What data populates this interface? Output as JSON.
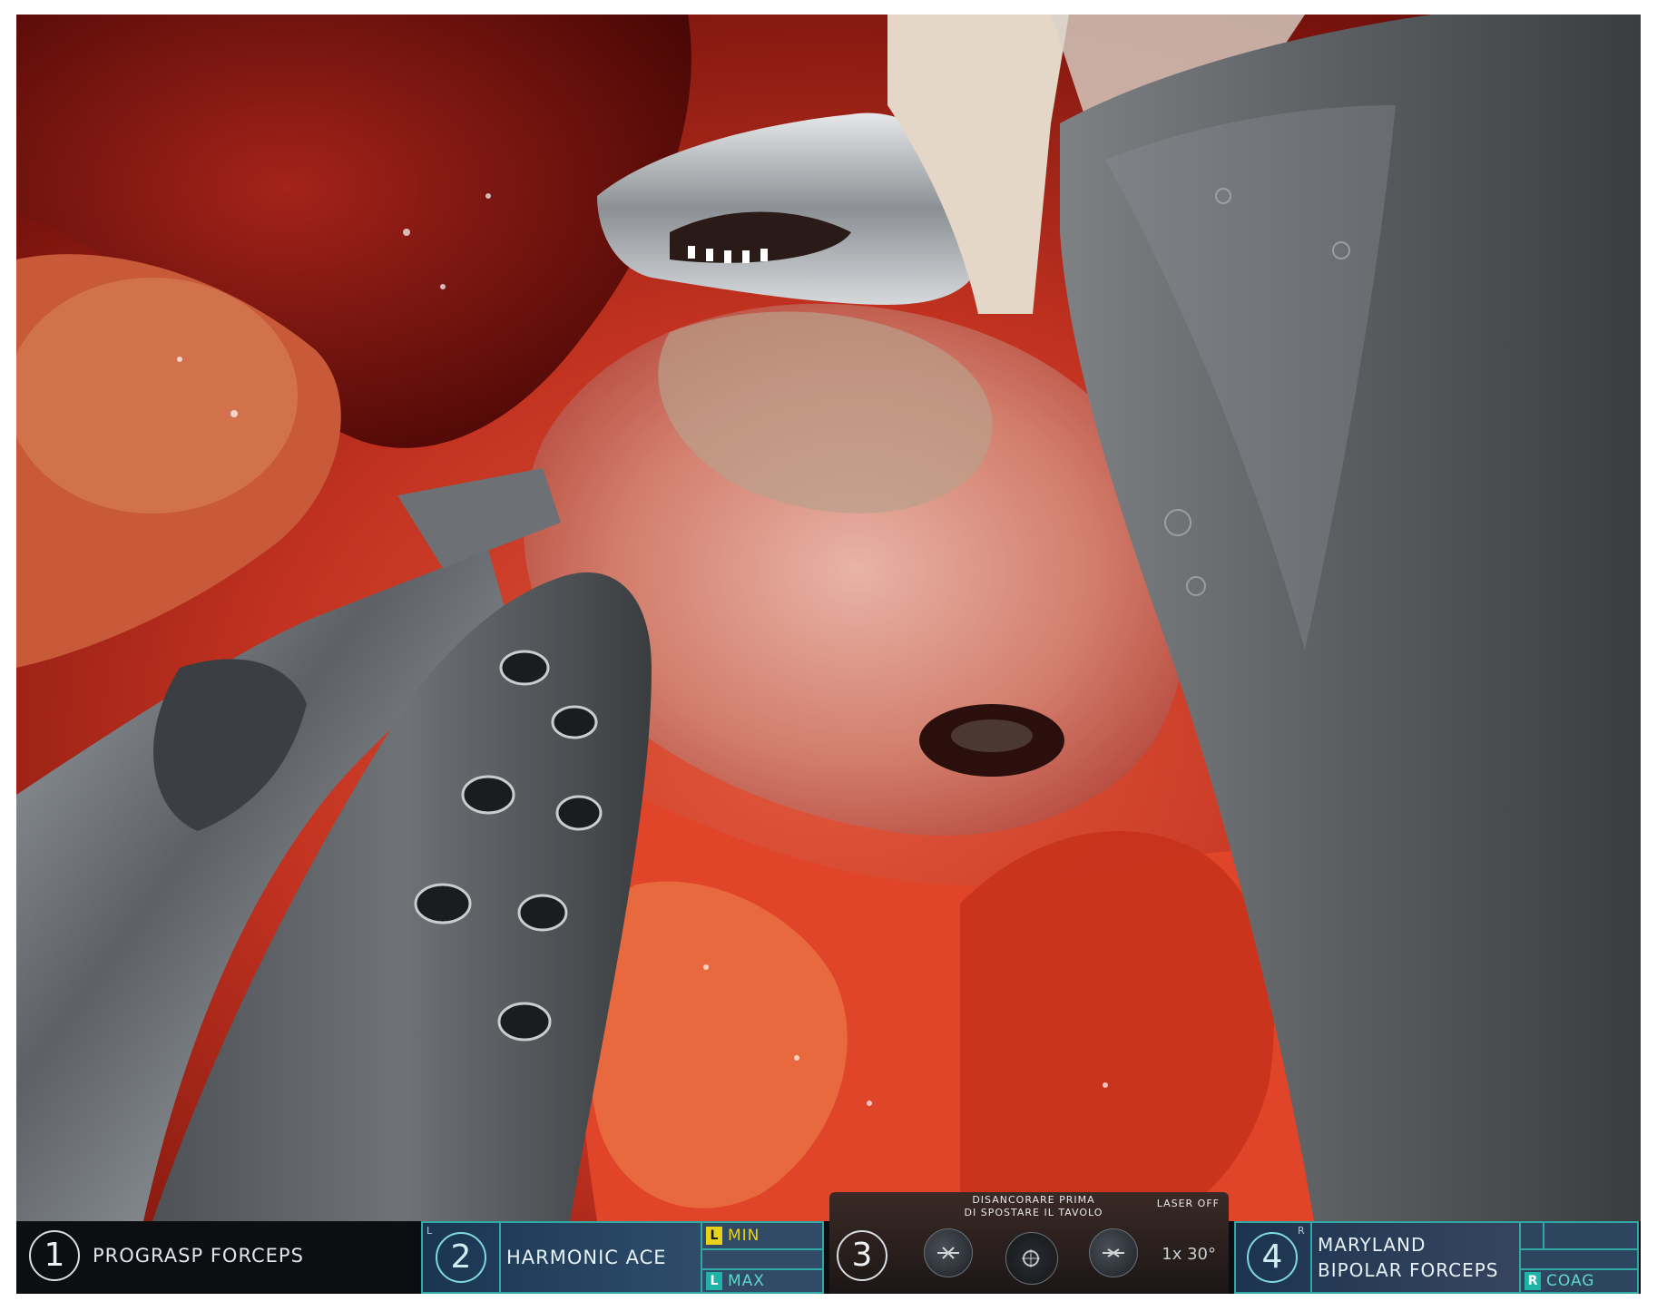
{
  "hud": {
    "arm1": {
      "number": "1",
      "instrument": "PROGRASP FORCEPS"
    },
    "arm2": {
      "number": "2",
      "instrument": "HARMONIC ACE",
      "side": "L",
      "energy_top": {
        "key": "L",
        "label": "MIN"
      },
      "energy_bottom": {
        "key": "L",
        "label": "MAX"
      }
    },
    "arm3": {
      "number": "3",
      "warning_line1": "DISANCORARE PRIMA",
      "warning_line2": "DI SPOSTARE IL TAVOLO",
      "laser": "LASER OFF",
      "zoom": "1x  30°"
    },
    "arm4": {
      "number": "4",
      "instrument_line1": "MARYLAND",
      "instrument_line2": "BIPOLAR FORCEPS",
      "side": "R",
      "energy_bottom": {
        "key": "R",
        "label": "COAG"
      }
    }
  },
  "colors": {
    "hud_background": "#0b0d12",
    "active_border": "#2fa9a6",
    "energy_key_yellow": "#e8d21a",
    "energy_key_teal": "#1fb3a8",
    "energy_text_yellow": "#e8d21a",
    "energy_text_teal": "#5fd6cc"
  }
}
